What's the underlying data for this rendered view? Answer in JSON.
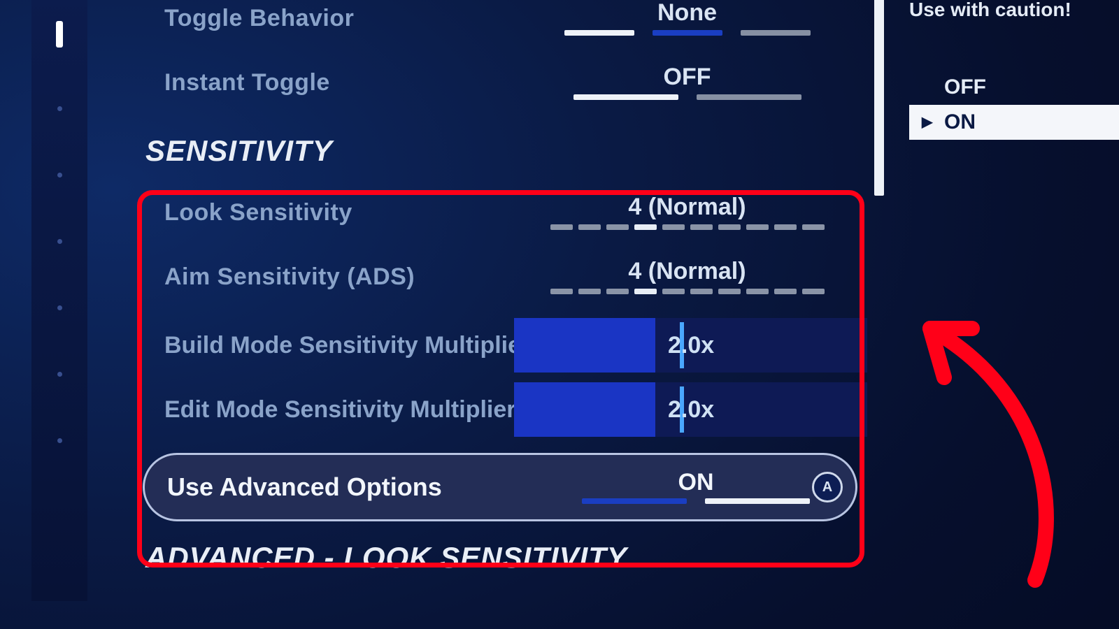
{
  "settings": {
    "toggle_behavior": {
      "label": "Toggle Behavior",
      "value": "None"
    },
    "instant_toggle": {
      "label": "Instant Toggle",
      "value": "OFF"
    },
    "section_sensitivity": "SENSITIVITY",
    "look_sensitivity": {
      "label": "Look Sensitivity",
      "value": "4 (Normal)",
      "index": 4,
      "count": 10
    },
    "aim_sensitivity": {
      "label": "Aim Sensitivity (ADS)",
      "value": "4 (Normal)",
      "index": 4,
      "count": 10
    },
    "build_mult": {
      "label": "Build Mode Sensitivity Multiplier",
      "value": "2.0x",
      "fill_pct": 40,
      "mark_pct": 47
    },
    "edit_mult": {
      "label": "Edit Mode Sensitivity Multiplier",
      "value": "2.0x",
      "fill_pct": 40,
      "mark_pct": 47
    },
    "use_advanced": {
      "label": "Use Advanced Options",
      "value": "ON",
      "button": "A"
    },
    "section_advanced": "ADVANCED - LOOK SENSITIVITY"
  },
  "help": {
    "warn_line2": "Use with caution!",
    "off": "OFF",
    "on": "ON"
  }
}
